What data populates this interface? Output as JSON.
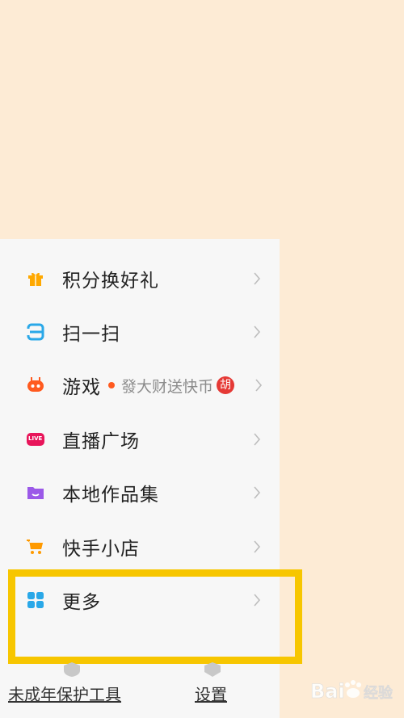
{
  "menu": {
    "items": [
      {
        "label": "积分换好礼",
        "icon": "gift-icon"
      },
      {
        "label": "扫一扫",
        "icon": "scan-icon"
      },
      {
        "label": "游戏",
        "icon": "game-controller-icon",
        "promo": "發大财送快币",
        "promo_avatar": "胡"
      },
      {
        "label": "直播广场",
        "icon": "live-badge-icon",
        "icon_text": "LIVE"
      },
      {
        "label": "本地作品集",
        "icon": "folder-icon"
      },
      {
        "label": "快手小店",
        "icon": "shopping-cart-icon"
      },
      {
        "label": "更多",
        "icon": "grid-icon"
      }
    ]
  },
  "footer": {
    "minor_protection": "未成年保护工具",
    "settings": "设置"
  },
  "watermark": "Bai du 经验",
  "colors": {
    "background": "#FDEBD5",
    "drawer": "#F7F7F7",
    "highlight": "#F7C600",
    "gift": "#FFA800",
    "scan": "#2AA8E8",
    "game": "#FF5A1F",
    "live": "#E8155A",
    "folder": "#9B59E8",
    "cart": "#FF9A00",
    "grid": "#2AA8E8"
  }
}
